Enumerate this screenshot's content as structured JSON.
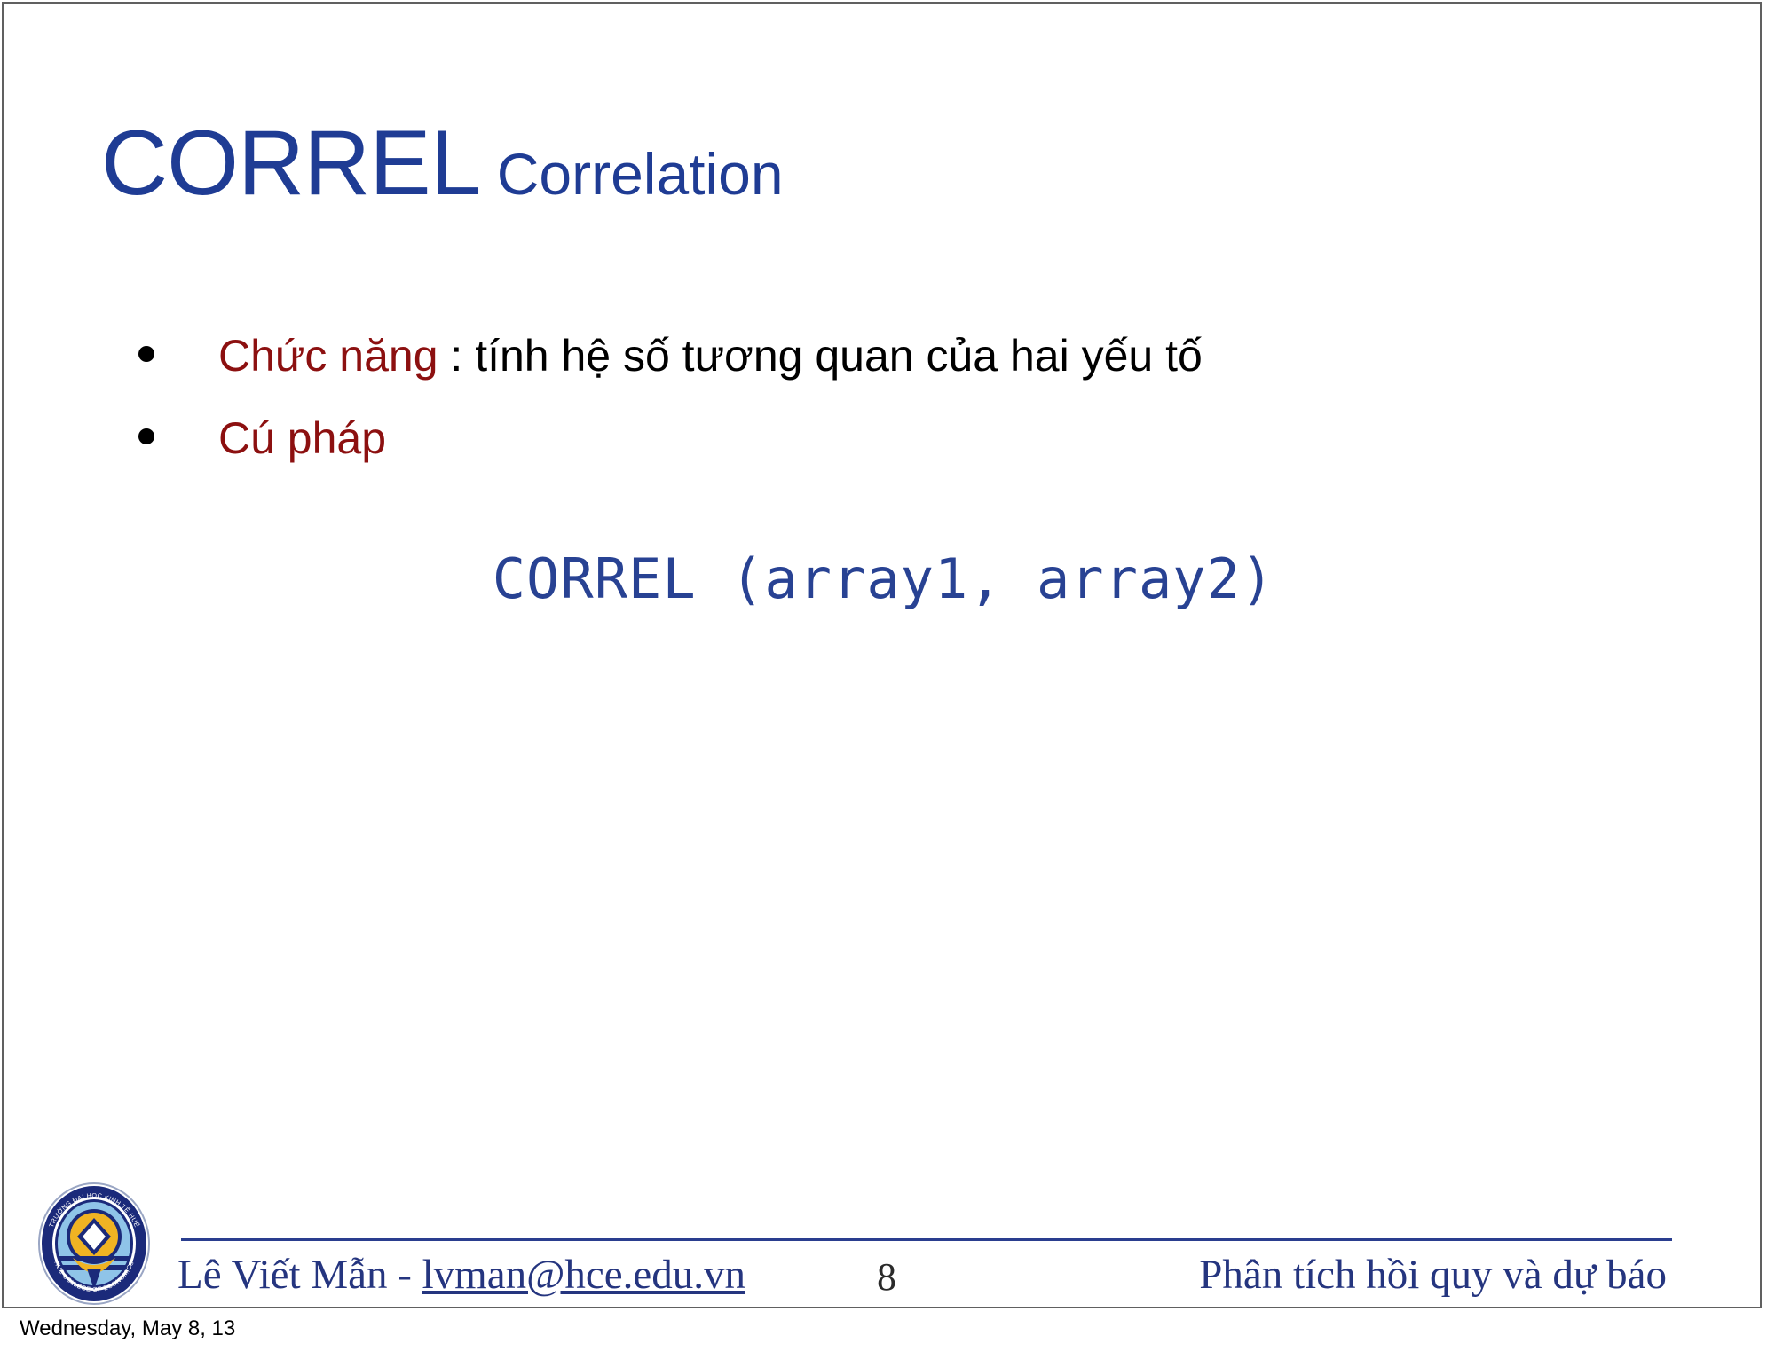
{
  "slide": {
    "title": {
      "main": "CORREL",
      "sub": " Correlation",
      "color": "#1F3C94"
    },
    "bullets": [
      {
        "accent": "Chức năng",
        "rest": " : tính hệ số tương quan của hai yếu tố"
      },
      {
        "accent": "Cú pháp",
        "rest": ""
      }
    ],
    "code": "CORREL (array1, array2)",
    "code_color": "#284293",
    "accent_color": "#8C1010"
  },
  "footer": {
    "author_name": "Lê Viết Mẫn - ",
    "author_email": "lvman@hce.edu.vn",
    "page_number": "8",
    "course": "Phân tích hồi quy và dự báo",
    "logo": {
      "top_text": "TRƯỜNG ĐẠI HỌC KINH TẾ HUẾ",
      "bottom_text": "HUE COLLEGE OF ECONOMICS",
      "ring_color": "#1B2A7A",
      "disc_color": "#8FC4E8",
      "emblem_color": "#F0B323"
    }
  },
  "caption": {
    "date": "Wednesday, May 8, 13"
  }
}
